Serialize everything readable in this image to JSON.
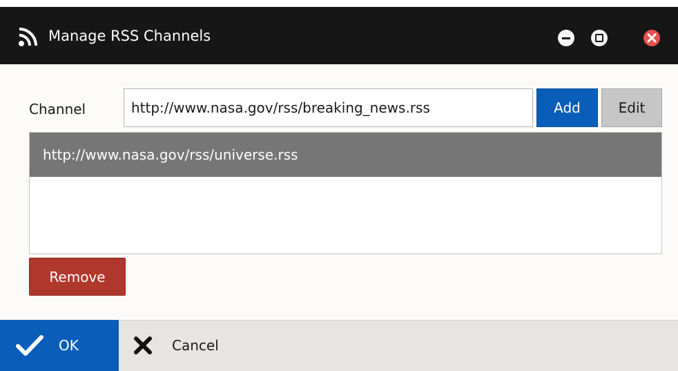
{
  "window": {
    "title": "Manage RSS Channels",
    "icon": "rss-icon",
    "controls": [
      "minimize-icon",
      "maximize-icon",
      "close-icon"
    ]
  },
  "form": {
    "channel_label": "Channel",
    "channel_value": "http://www.nasa.gov/rss/breaking_news.rss",
    "add_label": "Add",
    "edit_label": "Edit"
  },
  "channels": {
    "items": [
      "http://www.nasa.gov/rss/universe.rss"
    ],
    "selected_index": 0
  },
  "remove_label": "Remove",
  "footer": {
    "ok_label": "OK",
    "cancel_label": "Cancel"
  },
  "colors": {
    "titlebar": "#161616",
    "primary": "#0a5db8",
    "danger": "#b0372c",
    "selected_row": "#767676",
    "close_button": "#e9524f"
  }
}
